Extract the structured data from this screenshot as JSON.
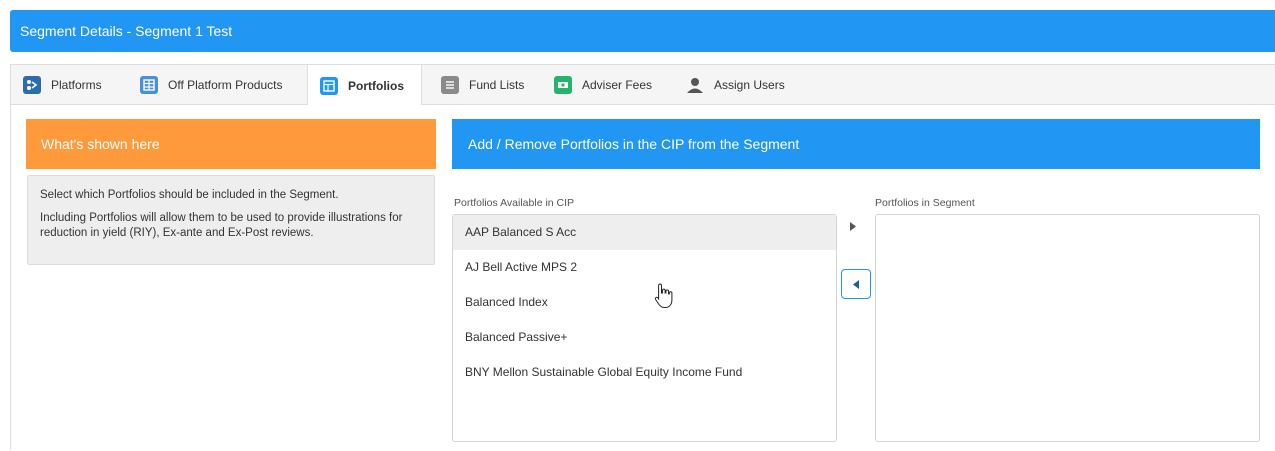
{
  "header": {
    "title": "Segment Details - Segment 1 Test"
  },
  "tabs": [
    {
      "label": "Platforms",
      "icon": "platforms-icon"
    },
    {
      "label": "Off Platform Products",
      "icon": "table-icon"
    },
    {
      "label": "Portfolios",
      "icon": "portfolio-icon",
      "active": true
    },
    {
      "label": "Fund Lists",
      "icon": "list-icon"
    },
    {
      "label": "Adviser Fees",
      "icon": "money-icon"
    },
    {
      "label": "Assign Users",
      "icon": "user-icon"
    }
  ],
  "info": {
    "heading": "What's shown here",
    "line1": "Select which Portfolios should be included in the Segment.",
    "line2": "Including Portfolios will allow them to be used to provide illustrations for reduction in yield (RIY), Ex-ante and Ex-Post reviews."
  },
  "manage": {
    "heading": "Add / Remove Portfolios in the CIP from the Segment",
    "available_label": "Portfolios Available in CIP",
    "segment_label": "Portfolios in Segment",
    "available": [
      "AAP Balanced S Acc",
      "AJ Bell Active MPS 2",
      "Balanced Index",
      "Balanced Passive+",
      "BNY Mellon Sustainable Global Equity Income Fund"
    ],
    "in_segment": []
  },
  "colors": {
    "primary": "#2196f3",
    "orange": "#ff9a3c",
    "tab_bg": "#f5f5f5"
  }
}
